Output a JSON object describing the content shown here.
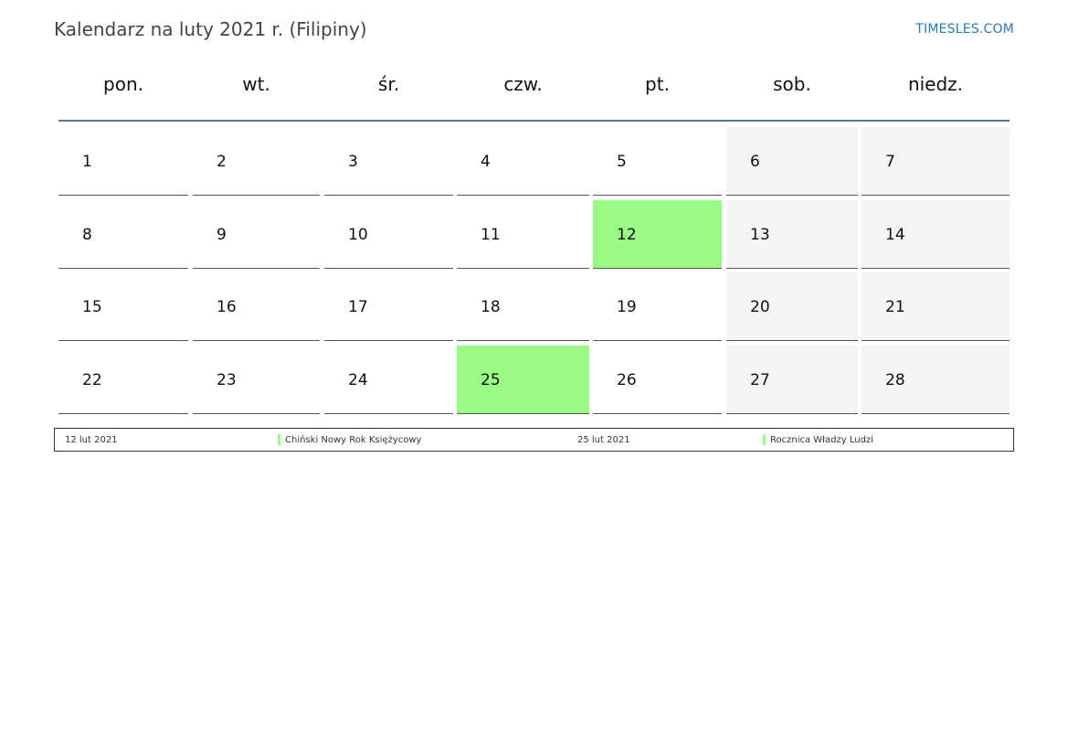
{
  "header": {
    "title": "Kalendarz na luty 2021 r. (Filipiny)",
    "site": "TIMESLES.COM"
  },
  "weekdays": [
    "pon.",
    "wt.",
    "śr.",
    "czw.",
    "pt.",
    "sob.",
    "niedz."
  ],
  "weeks": [
    [
      "1",
      "2",
      "3",
      "4",
      "5",
      "6",
      "7"
    ],
    [
      "8",
      "9",
      "10",
      "11",
      "12",
      "13",
      "14"
    ],
    [
      "15",
      "16",
      "17",
      "18",
      "19",
      "20",
      "21"
    ],
    [
      "22",
      "23",
      "24",
      "25",
      "26",
      "27",
      "28"
    ]
  ],
  "holiday_days": [
    "12",
    "25"
  ],
  "holiday_color": "#99fb86",
  "weekend_color": "#f4f4f4",
  "legend": [
    {
      "date": "12 lut 2021",
      "name": "Chiński Nowy Rok Księżycowy"
    },
    {
      "date": "25 lut 2021",
      "name": "Rocznica Władzy Ludzi"
    }
  ]
}
